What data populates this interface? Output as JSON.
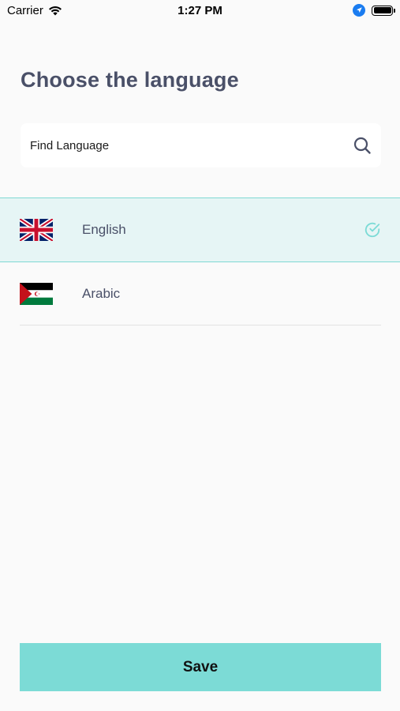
{
  "status_bar": {
    "carrier": "Carrier",
    "time": "1:27 PM"
  },
  "page": {
    "title": "Choose the language"
  },
  "search": {
    "placeholder": "Find Language",
    "icon": "search-icon"
  },
  "languages": [
    {
      "label": "English",
      "flag": "uk-flag",
      "selected": true
    },
    {
      "label": "Arabic",
      "flag": "arabic-flag",
      "selected": false
    }
  ],
  "footer": {
    "save_label": "Save"
  },
  "colors": {
    "accent": "#7cdbd6",
    "selected_bg": "#e6f5f5",
    "title": "#4a5068"
  }
}
